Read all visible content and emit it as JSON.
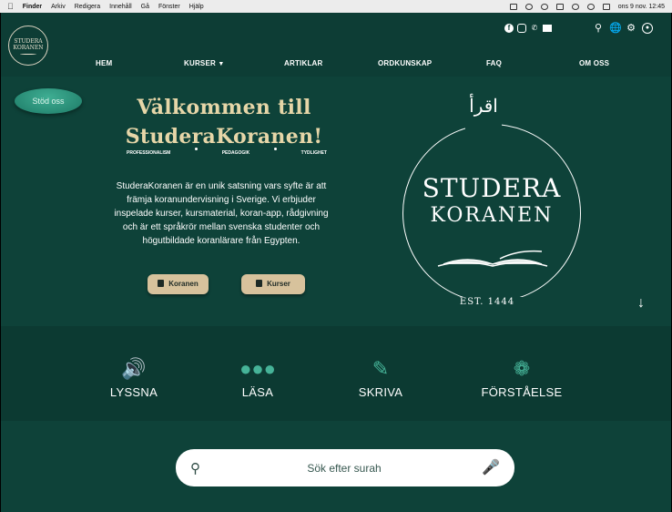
{
  "menubar": {
    "app": "Finder",
    "items": [
      "Arkiv",
      "Redigera",
      "Innehåll",
      "Gå",
      "Fönster",
      "Hjälp"
    ],
    "clock": "ons 9 nov. 12:45"
  },
  "header": {
    "logo_line1": "STUDERA",
    "logo_line2": "KORANEN",
    "social_icons": [
      "facebook-icon",
      "instagram-icon",
      "phone-icon",
      "mail-icon"
    ],
    "tool_icons": [
      "search-icon",
      "globe-icon",
      "gear-icon",
      "user-icon"
    ]
  },
  "nav": {
    "items": [
      {
        "label": "HEM"
      },
      {
        "label": "KURSER",
        "dropdown": true
      },
      {
        "label": "ARTIKLAR"
      },
      {
        "label": "ORDKUNSKAP"
      },
      {
        "label": "FAQ"
      },
      {
        "label": "OM OSS"
      }
    ]
  },
  "hero": {
    "support_button": "Stöd oss",
    "welcome_line1": "Välkommen till",
    "welcome_line2": "StuderaKoranen!",
    "pillars": [
      "PROFESSIONALISM",
      "PEDAGOGIK",
      "TYDLIGHET"
    ],
    "intro": "StuderaKoranen är en unik satsning vars syfte är att främja koranundervisning i Sverige. Vi erbjuder  inspelade kurser, kursmaterial, koran-app, rådgivning och är ett språkrör mellan svenska studenter och högutbildade koranlärare från Egypten.",
    "buttons": [
      {
        "label": "Koranen",
        "icon": "book-icon"
      },
      {
        "label": "Kurser",
        "icon": "library-icon"
      }
    ],
    "emblem": {
      "arabic": "اقرأ",
      "line1": "STUDERA",
      "line2": "KORANEN",
      "est": "EST. 1444"
    }
  },
  "skills": [
    {
      "label": "LYSSNA",
      "icon": "speaker-icon"
    },
    {
      "label": "LÄSA",
      "icon": "reading-people-icon"
    },
    {
      "label": "SKRIVA",
      "icon": "pencil-icon"
    },
    {
      "label": "FÖRSTÅELSE",
      "icon": "brain-icon"
    }
  ],
  "search": {
    "placeholder": "Sök efter surah"
  },
  "colors": {
    "background": "#0e4239",
    "accent": "#46b398",
    "gold": "#e6d6a8",
    "button": "#d7c29c"
  }
}
